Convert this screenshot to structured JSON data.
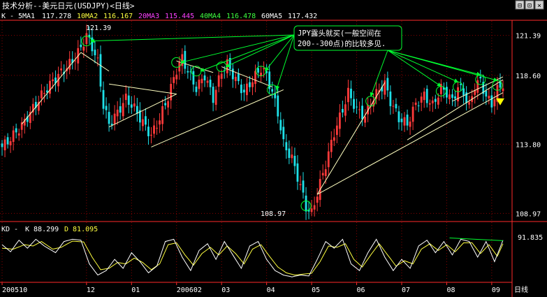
{
  "window": {
    "title": "技术分析--美元日元(USDJPY)<日线>",
    "controls": [
      "⊟",
      "⊡",
      "×"
    ]
  },
  "colors": {
    "background": "#000000",
    "grid": "#8b0000",
    "axis": "#ff2a2a",
    "candle_up": "#ff3a3a",
    "candle_down": "#1ee0e8",
    "ma_label_white": "#ffffff",
    "ma_label_yellow": "#ffff40",
    "ma_label_magenta": "#ff40ff",
    "ma_label_green": "#40ff40",
    "trend_line": "#ffffc0",
    "annotation": "#00ff30",
    "kd_k": "#ffffff",
    "kd_d": "#ffff40"
  },
  "indicators": {
    "main_prefix": "K - ",
    "ma": [
      {
        "name": "5MA1",
        "value": "117.278",
        "color": "#ffffff"
      },
      {
        "name": "10MA2",
        "value": "116.167",
        "color": "#ffff40"
      },
      {
        "name": "20MA3",
        "value": "115.445",
        "color": "#ff40ff"
      },
      {
        "name": "40MA4",
        "value": "116.478",
        "color": "#40ff40"
      },
      {
        "name": "60MA5",
        "value": "117.432",
        "color": "#ffffff"
      }
    ],
    "kd_prefix": "KD - ",
    "kd_k": "K 88.299",
    "kd_d": "D 81.095"
  },
  "annotation": {
    "line1": "JPY露头就买(一般空间在",
    "line2": "200--300点)的比较多见."
  },
  "chart_data": {
    "type": "candlestick",
    "title": "技术分析--美元日元(USDJPY)<日线>",
    "y_ticks": [
      "121.39",
      "118.60",
      "113.80",
      "108.97"
    ],
    "y_tick_values": [
      121.39,
      118.6,
      113.8,
      108.97
    ],
    "ylim": [
      108.6,
      122.3
    ],
    "peak_label": "121.39",
    "trough_label": "108.97",
    "x_ticks": [
      "200510",
      "12",
      "01",
      "200602",
      "03",
      "04",
      "05",
      "06",
      "07",
      "08",
      "09",
      "日线"
    ],
    "anchors": [
      [
        0,
        113.6
      ],
      [
        3,
        114.2
      ],
      [
        7,
        115.1
      ],
      [
        10,
        116.0
      ],
      [
        14,
        117.2
      ],
      [
        18,
        118.2
      ],
      [
        22,
        119.0
      ],
      [
        25,
        119.6
      ],
      [
        28,
        120.5
      ],
      [
        30,
        121.39
      ],
      [
        32,
        120.6
      ],
      [
        34,
        119.5
      ],
      [
        36,
        116.5
      ],
      [
        38,
        115.2
      ],
      [
        41,
        116.0
      ],
      [
        44,
        117.0
      ],
      [
        47,
        116.3
      ],
      [
        50,
        115.3
      ],
      [
        53,
        114.4
      ],
      [
        56,
        115.6
      ],
      [
        59,
        117.1
      ],
      [
        62,
        119.0
      ],
      [
        64,
        119.8
      ],
      [
        66,
        118.9
      ],
      [
        69,
        117.7
      ],
      [
        72,
        118.6
      ],
      [
        75,
        117.0
      ],
      [
        78,
        118.9
      ],
      [
        80,
        119.4
      ],
      [
        83,
        118.3
      ],
      [
        86,
        117.4
      ],
      [
        89,
        118.3
      ],
      [
        92,
        119.1
      ],
      [
        94,
        118.6
      ],
      [
        96,
        117.4
      ],
      [
        98,
        116.0
      ],
      [
        100,
        113.8
      ],
      [
        103,
        112.8
      ],
      [
        106,
        110.9
      ],
      [
        108,
        109.4
      ],
      [
        110,
        108.97
      ],
      [
        112,
        110.4
      ],
      [
        115,
        112.4
      ],
      [
        118,
        114.6
      ],
      [
        121,
        116.2
      ],
      [
        123,
        117.4
      ],
      [
        126,
        116.2
      ],
      [
        129,
        115.7
      ],
      [
        131,
        116.7
      ],
      [
        134,
        117.6
      ],
      [
        136,
        118.0
      ],
      [
        138,
        116.8
      ],
      [
        141,
        115.6
      ],
      [
        144,
        115.2
      ],
      [
        147,
        116.6
      ],
      [
        150,
        117.2
      ],
      [
        153,
        116.5
      ],
      [
        156,
        117.7
      ],
      [
        158,
        117.4
      ],
      [
        160,
        116.8
      ],
      [
        162,
        117.8
      ],
      [
        164,
        117.4
      ],
      [
        166,
        116.4
      ],
      [
        168,
        117.9
      ],
      [
        170,
        118.2
      ],
      [
        172,
        117.1
      ],
      [
        174,
        116.6
      ],
      [
        176,
        117.6
      ],
      [
        178,
        118.0
      ]
    ],
    "kd": {
      "ylim": [
        0,
        100
      ],
      "tick": "91.835",
      "k_anchors": [
        [
          0,
          78
        ],
        [
          3,
          62
        ],
        [
          6,
          88
        ],
        [
          9,
          70
        ],
        [
          12,
          90
        ],
        [
          15,
          75
        ],
        [
          19,
          60
        ],
        [
          22,
          85
        ],
        [
          25,
          90
        ],
        [
          28,
          88
        ],
        [
          31,
          35
        ],
        [
          34,
          10
        ],
        [
          37,
          20
        ],
        [
          40,
          45
        ],
        [
          43,
          25
        ],
        [
          46,
          60
        ],
        [
          49,
          40
        ],
        [
          52,
          15
        ],
        [
          55,
          30
        ],
        [
          58,
          85
        ],
        [
          61,
          90
        ],
        [
          64,
          50
        ],
        [
          67,
          20
        ],
        [
          70,
          65
        ],
        [
          73,
          80
        ],
        [
          76,
          45
        ],
        [
          79,
          85
        ],
        [
          82,
          55
        ],
        [
          85,
          25
        ],
        [
          88,
          75
        ],
        [
          91,
          85
        ],
        [
          94,
          45
        ],
        [
          97,
          20
        ],
        [
          100,
          10
        ],
        [
          103,
          6
        ],
        [
          106,
          10
        ],
        [
          109,
          8
        ],
        [
          112,
          45
        ],
        [
          115,
          85
        ],
        [
          118,
          70
        ],
        [
          121,
          90
        ],
        [
          124,
          35
        ],
        [
          127,
          20
        ],
        [
          130,
          60
        ],
        [
          133,
          90
        ],
        [
          136,
          50
        ],
        [
          139,
          20
        ],
        [
          142,
          45
        ],
        [
          145,
          25
        ],
        [
          148,
          75
        ],
        [
          151,
          88
        ],
        [
          154,
          60
        ],
        [
          157,
          85
        ],
        [
          160,
          55
        ],
        [
          163,
          90
        ],
        [
          166,
          85
        ],
        [
          169,
          50
        ],
        [
          172,
          85
        ],
        [
          175,
          40
        ],
        [
          178,
          88
        ]
      ],
      "d_anchors": [
        [
          0,
          70
        ],
        [
          4,
          68
        ],
        [
          8,
          78
        ],
        [
          11,
          75
        ],
        [
          14,
          85
        ],
        [
          18,
          68
        ],
        [
          21,
          72
        ],
        [
          25,
          86
        ],
        [
          29,
          84
        ],
        [
          32,
          50
        ],
        [
          35,
          22
        ],
        [
          38,
          25
        ],
        [
          41,
          38
        ],
        [
          44,
          35
        ],
        [
          47,
          48
        ],
        [
          50,
          38
        ],
        [
          53,
          22
        ],
        [
          56,
          35
        ],
        [
          59,
          78
        ],
        [
          62,
          82
        ],
        [
          65,
          55
        ],
        [
          68,
          32
        ],
        [
          71,
          58
        ],
        [
          74,
          72
        ],
        [
          77,
          55
        ],
        [
          80,
          75
        ],
        [
          83,
          58
        ],
        [
          86,
          35
        ],
        [
          89,
          68
        ],
        [
          92,
          78
        ],
        [
          95,
          52
        ],
        [
          98,
          28
        ],
        [
          101,
          15
        ],
        [
          104,
          10
        ],
        [
          107,
          12
        ],
        [
          110,
          14
        ],
        [
          113,
          40
        ],
        [
          116,
          75
        ],
        [
          119,
          72
        ],
        [
          122,
          80
        ],
        [
          125,
          45
        ],
        [
          128,
          28
        ],
        [
          131,
          55
        ],
        [
          134,
          80
        ],
        [
          137,
          55
        ],
        [
          140,
          30
        ],
        [
          143,
          42
        ],
        [
          146,
          35
        ],
        [
          149,
          68
        ],
        [
          152,
          80
        ],
        [
          155,
          65
        ],
        [
          158,
          78
        ],
        [
          161,
          62
        ],
        [
          164,
          82
        ],
        [
          167,
          82
        ],
        [
          170,
          58
        ],
        [
          173,
          78
        ],
        [
          176,
          52
        ],
        [
          178,
          80
        ]
      ]
    }
  }
}
